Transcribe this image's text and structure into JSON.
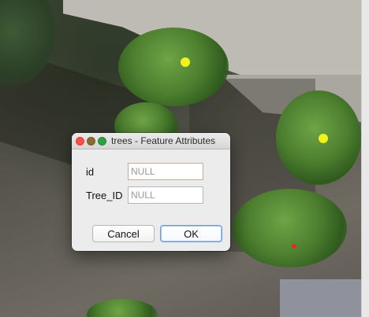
{
  "dialog": {
    "title": "trees - Feature Attributes",
    "fields": [
      {
        "label": "id",
        "placeholder": "NULL"
      },
      {
        "label": "Tree_ID",
        "placeholder": "NULL"
      }
    ],
    "buttons": {
      "cancel": "Cancel",
      "ok": "OK"
    }
  },
  "map": {
    "points": [
      {
        "color": "#f2f21b"
      },
      {
        "color": "#f2f21b"
      },
      {
        "color": "#e62b1e"
      }
    ]
  },
  "colors": {
    "close": "#fc4f4b",
    "minimize": "#8c6b33",
    "zoom": "#2ea043",
    "ok_focus": "#6e9fd9"
  }
}
